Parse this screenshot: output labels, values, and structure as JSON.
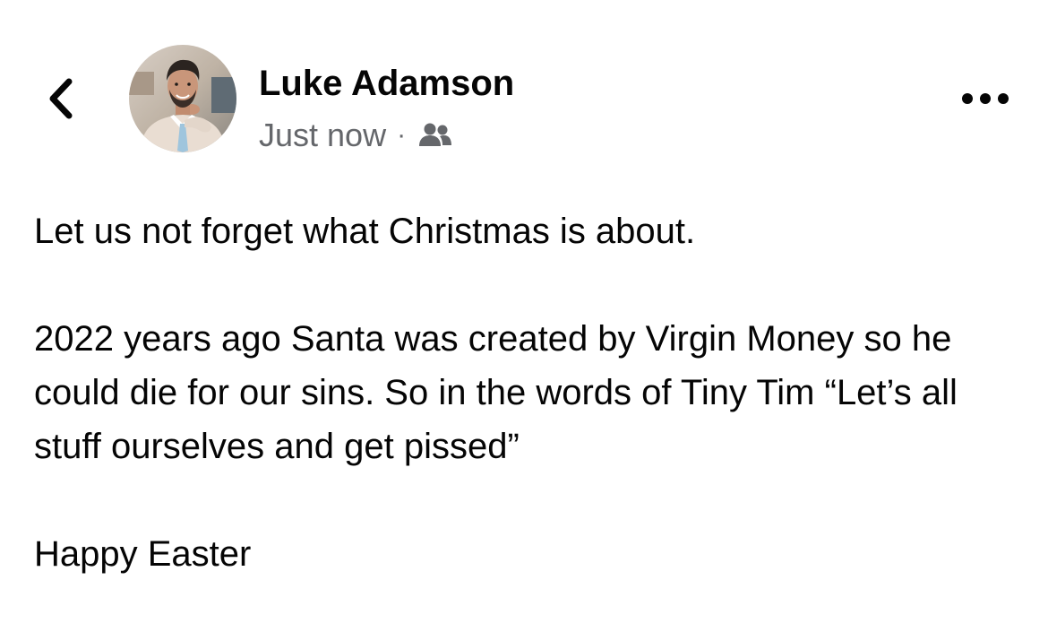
{
  "post": {
    "author_name": "Luke Adamson",
    "timestamp": "Just now",
    "separator": "·",
    "audience_icon": "friends-icon",
    "back_icon": "chevron-left-icon",
    "more_icon": "more-horizontal-icon",
    "body": {
      "paragraph_1": "Let us not forget what Christmas is about.",
      "paragraph_2": "2022 years ago Santa was created by Virgin Money so he could die for our sins. So in the words of Tiny Tim “Let’s all stuff ourselves and get pissed”",
      "paragraph_3": "Happy Easter"
    }
  },
  "colors": {
    "text_primary": "#050505",
    "text_secondary": "#65676b",
    "background": "#ffffff"
  }
}
